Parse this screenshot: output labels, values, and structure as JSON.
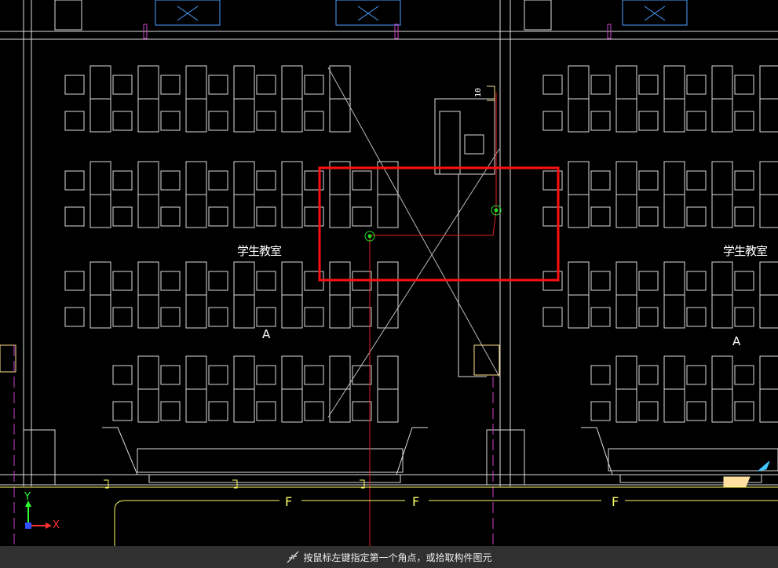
{
  "drawing": {
    "room_labels": [
      "学生教室",
      "学生教室"
    ],
    "axis_letters": [
      "A",
      "A"
    ],
    "grid_letters": [
      "F",
      "F",
      "F"
    ],
    "equipment_tag": "10",
    "ucs": {
      "x_label": "X",
      "y_label": "Y"
    }
  },
  "status_bar": {
    "prompt": "按鼠标左键指定第一个角点，或拾取构件图元",
    "icon": "crosshair-select-icon"
  },
  "colors": {
    "background": "#000000",
    "line_white": "#dcdcdc",
    "selection_red": "#ff1010",
    "grid_yellow": "#ffff66",
    "marker_green": "#22dd22",
    "magenta": "#cc44cc",
    "blue": "#4aa0ff",
    "status_bg": "#303030"
  }
}
